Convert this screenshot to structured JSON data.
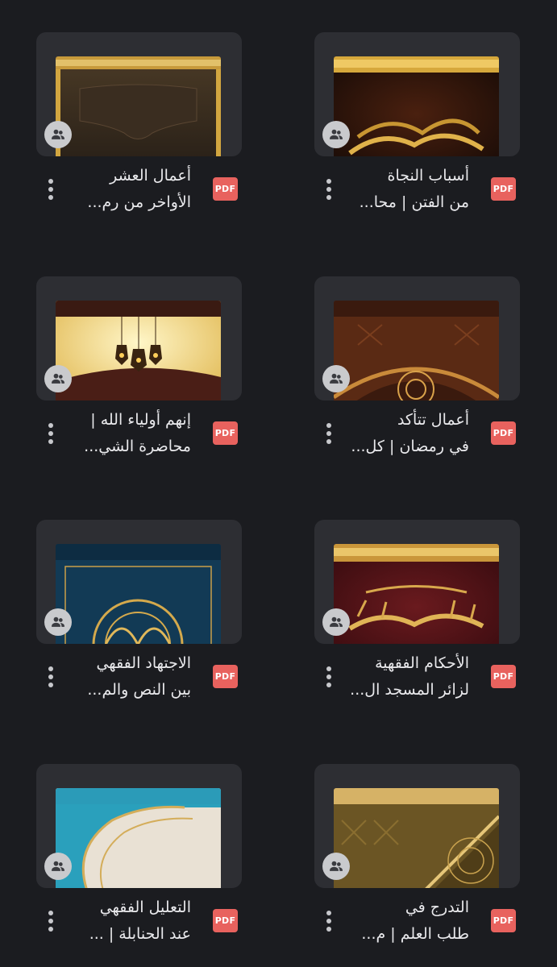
{
  "files": [
    {
      "title": "أعمال العشر\nالأواخر من رم...",
      "type_label": "PDF",
      "shared_icon": "people-icon",
      "menu_icon": "more-vert-icon"
    },
    {
      "title": "أسباب النجاة\nمن الفتن | محا...",
      "type_label": "PDF",
      "shared_icon": "people-icon",
      "menu_icon": "more-vert-icon"
    },
    {
      "title": "إنهم أولياء الله |\nمحاضرة الشي...",
      "type_label": "PDF",
      "shared_icon": "people-icon",
      "menu_icon": "more-vert-icon"
    },
    {
      "title": "أعمال تتأكد\nفي رمضان | كل...",
      "type_label": "PDF",
      "shared_icon": "people-icon",
      "menu_icon": "more-vert-icon"
    },
    {
      "title": "الاجتهاد الفقهي\nبين النص والم...",
      "type_label": "PDF",
      "shared_icon": "people-icon",
      "menu_icon": "more-vert-icon"
    },
    {
      "title": "الأحكام الفقهية\nلزائر المسجد ال...",
      "type_label": "PDF",
      "shared_icon": "people-icon",
      "menu_icon": "more-vert-icon"
    },
    {
      "title": "التعليل الفقهي\nعند الحنابلة | ...",
      "type_label": "PDF",
      "shared_icon": "people-icon",
      "menu_icon": "more-vert-icon"
    },
    {
      "title": "التدرج في\nطلب العلم | م...",
      "type_label": "PDF",
      "shared_icon": "people-icon",
      "menu_icon": "more-vert-icon"
    }
  ],
  "colors": {
    "background": "#1b1c20",
    "card": "#2d2e33",
    "pdf_badge": "#e8625e",
    "text": "#e9e9ec"
  }
}
